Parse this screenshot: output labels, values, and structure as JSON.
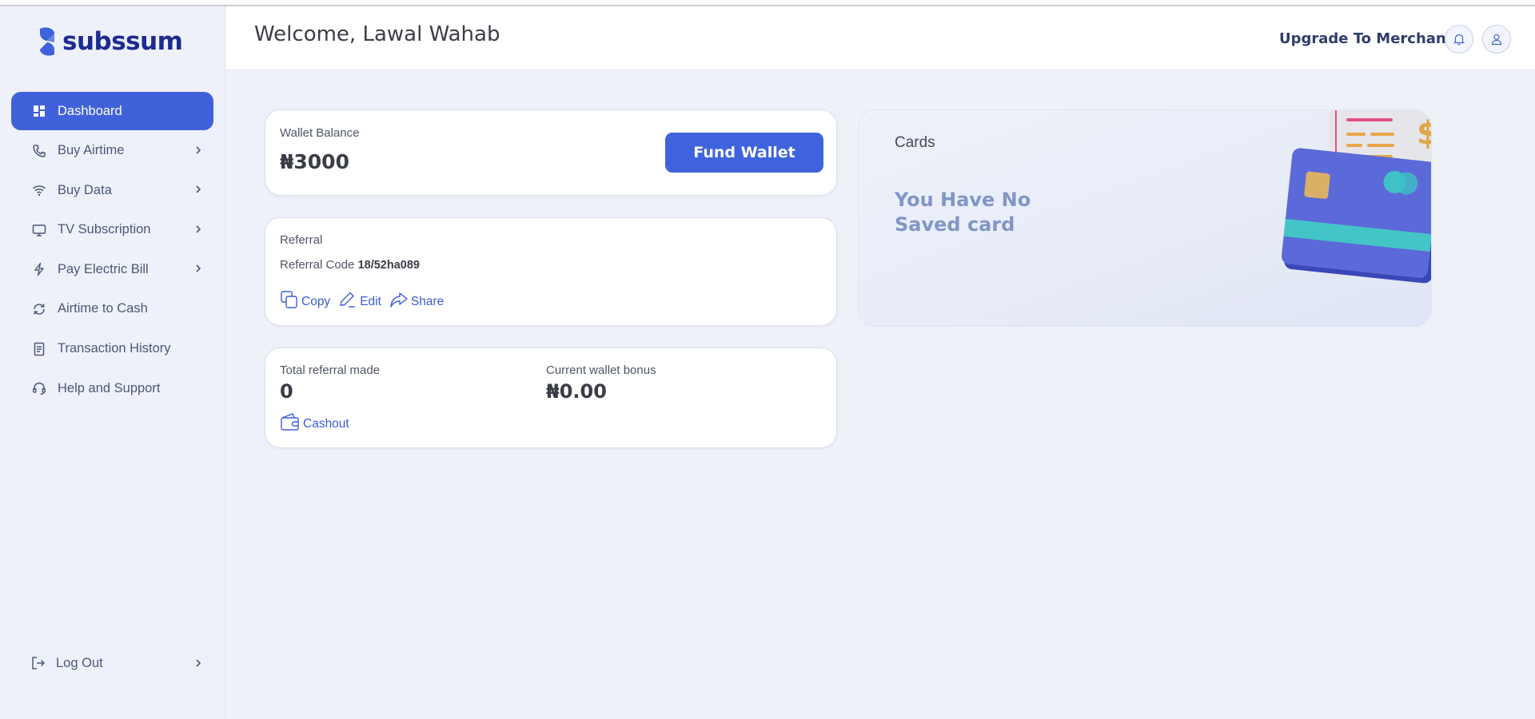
{
  "app": {
    "brand": "subssum"
  },
  "header": {
    "welcome": "Welcome, Lawal Wahab",
    "upgrade_label": "Upgrade To Merchant"
  },
  "sidebar": {
    "items": [
      {
        "label": "Dashboard",
        "icon": "grid-icon",
        "active": true,
        "has_chevron": false
      },
      {
        "label": "Buy Airtime",
        "icon": "phone-icon",
        "has_chevron": true
      },
      {
        "label": "Buy Data",
        "icon": "wifi-icon",
        "has_chevron": true
      },
      {
        "label": "TV Subscription",
        "icon": "tv-icon",
        "has_chevron": true
      },
      {
        "label": "Pay Electric Bill",
        "icon": "bolt-icon",
        "has_chevron": true
      },
      {
        "label": "Airtime to Cash",
        "icon": "refresh-icon",
        "has_chevron": false
      },
      {
        "label": "Transaction History",
        "icon": "receipt-icon",
        "has_chevron": false
      },
      {
        "label": "Help and Support",
        "icon": "headset-icon",
        "has_chevron": false
      }
    ],
    "logout_label": "Log Out"
  },
  "wallet": {
    "label": "Wallet Balance",
    "amount": "₦3000",
    "fund_button": "Fund Wallet"
  },
  "referral": {
    "label": "Referral",
    "code_label": "Referral Code",
    "code_value": "18/52ha089",
    "actions": {
      "copy": "Copy",
      "edit": "Edit",
      "share": "Share"
    }
  },
  "stats": {
    "total_referral_label": "Total referral made",
    "total_referral_value": "0",
    "bonus_label": "Current wallet bonus",
    "bonus_value": "₦0.00",
    "cashout_label": "Cashout"
  },
  "cards": {
    "title": "Cards",
    "empty_message": "You Have No Saved card"
  },
  "colors": {
    "accent": "#3e63dc",
    "brand": "#1d2b8f",
    "link": "#3e5bd6",
    "muted_heading": "#8196c6"
  }
}
